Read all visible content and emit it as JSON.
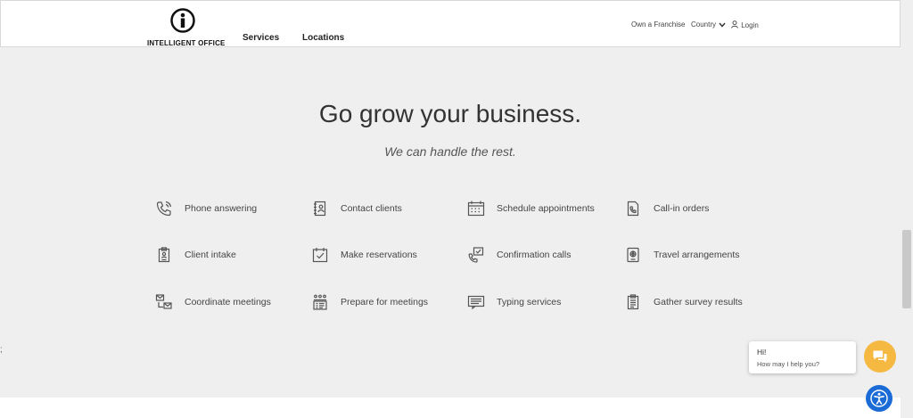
{
  "header": {
    "logo_text": "INTELLIGENT OFFICE",
    "nav": [
      "Services",
      "Locations"
    ],
    "own_franchise": "Own a Franchise",
    "country": "Country",
    "login": "Login"
  },
  "hero": {
    "title": "Go grow your business.",
    "subtitle": "We can handle the rest."
  },
  "services": [
    {
      "label": "Phone answering",
      "icon": "phone-icon"
    },
    {
      "label": "Contact clients",
      "icon": "address-book-icon"
    },
    {
      "label": "Schedule appointments",
      "icon": "calendar-icon"
    },
    {
      "label": "Call-in orders",
      "icon": "phone-document-icon"
    },
    {
      "label": "Client intake",
      "icon": "clipboard-badge-icon"
    },
    {
      "label": "Make reservations",
      "icon": "calendar-check-icon"
    },
    {
      "label": "Confirmation calls",
      "icon": "phone-check-icon"
    },
    {
      "label": "Travel arrangements",
      "icon": "passport-icon"
    },
    {
      "label": "Coordinate meetings",
      "icon": "meeting-invite-icon"
    },
    {
      "label": "Prepare for meetings",
      "icon": "agenda-icon"
    },
    {
      "label": "Typing services",
      "icon": "keyboard-icon"
    },
    {
      "label": "Gather survey results",
      "icon": "clipboard-list-icon"
    }
  ],
  "chat": {
    "greeting": "Hi!",
    "prompt": "How may I help you?"
  },
  "stray_text": ";",
  "colors": {
    "chat_button": "#f5b840",
    "accessibility_button": "#1a6bd6",
    "background": "#efefef"
  }
}
